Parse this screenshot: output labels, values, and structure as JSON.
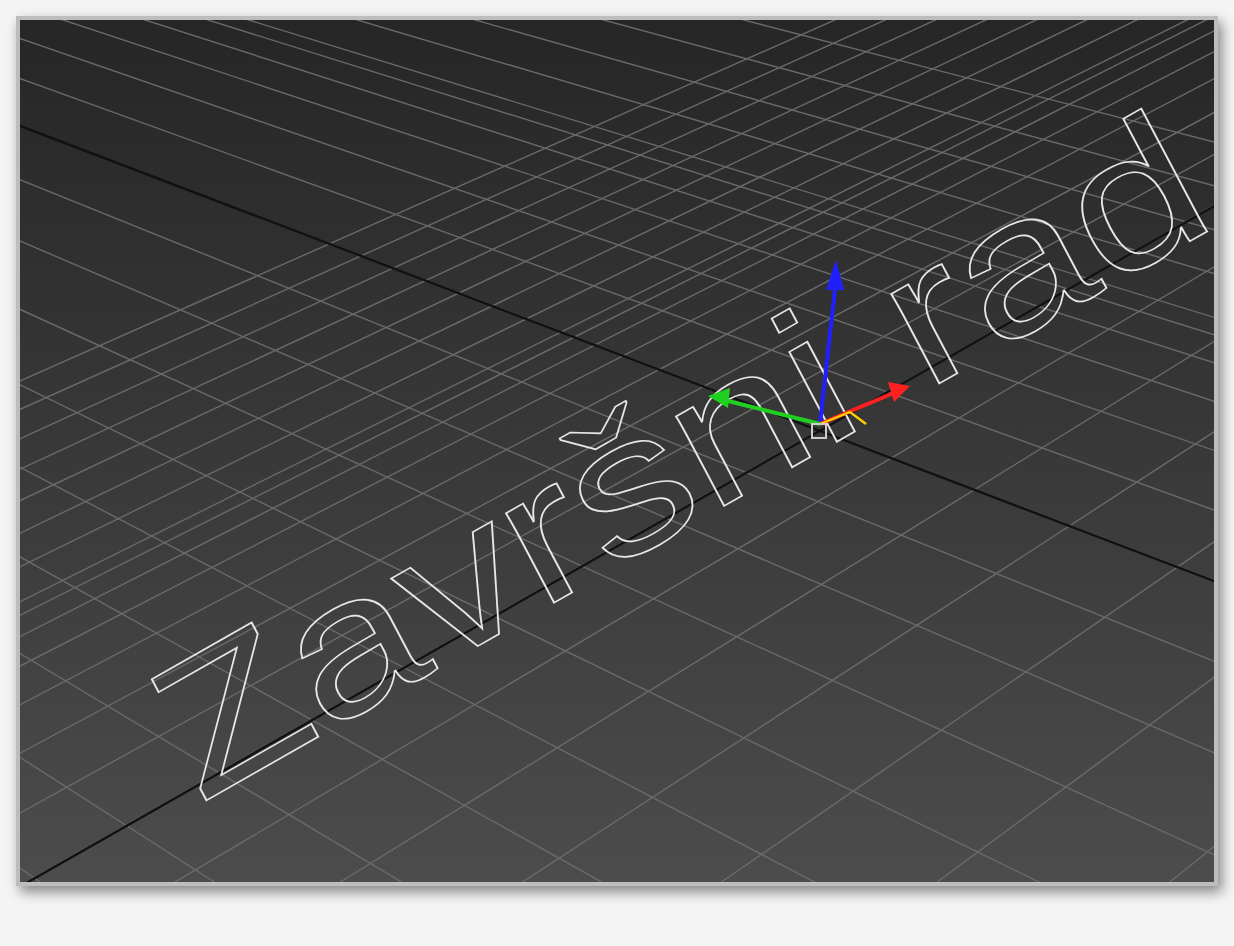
{
  "viewport": {
    "text_object": "Završni rad"
  }
}
